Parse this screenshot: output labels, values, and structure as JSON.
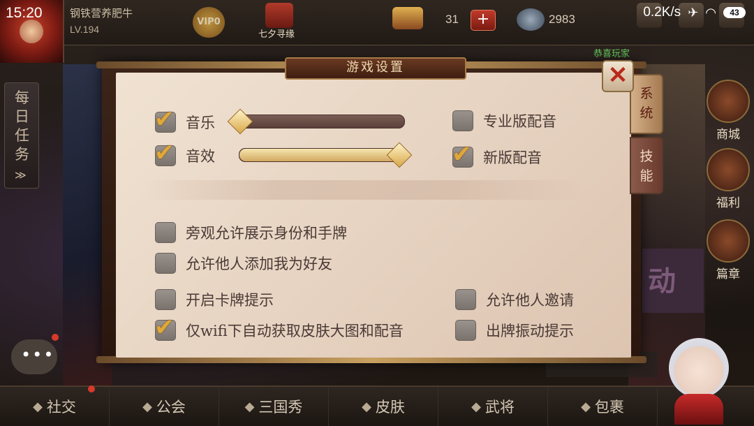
{
  "status_bar": {
    "time": "15:20",
    "network_speed": "0.2K/s",
    "battery": "43"
  },
  "player": {
    "name": "钢铁营养肥牛",
    "level": "LV.194",
    "vip": "VIP0"
  },
  "top_bar": {
    "event_label": "七夕寻缘",
    "gold_count": "31",
    "add_label": "+",
    "coin_count": "2983"
  },
  "daily_tasks": {
    "label": "每日任务",
    "arrow": "≫"
  },
  "side_nav": [
    {
      "label": "商城",
      "icon": "shop-icon"
    },
    {
      "label": "福利",
      "icon": "gift-icon"
    },
    {
      "label": "篇章",
      "icon": "fan-icon"
    }
  ],
  "background": {
    "banner_char": "动"
  },
  "toast": {
    "text": "恭喜玩家"
  },
  "dialog": {
    "title": "游戏设置",
    "close_label": "✕",
    "tabs": [
      {
        "label": "系统",
        "active": true
      },
      {
        "label": "技能",
        "active": false
      }
    ],
    "volume": [
      {
        "label": "音乐",
        "checked": true,
        "level": 0.0
      },
      {
        "label": "音效",
        "checked": true,
        "level": 1.0
      }
    ],
    "voice_options": [
      {
        "label": "专业版配音",
        "checked": false
      },
      {
        "label": "新版配音",
        "checked": true
      }
    ],
    "options_left": [
      {
        "label": "旁观允许展示身份和手牌",
        "checked": false
      },
      {
        "label": "允许他人添加我为好友",
        "checked": false
      },
      {
        "label": "开启卡牌提示",
        "checked": false
      },
      {
        "label": "仅wifi下自动获取皮肤大图和配音",
        "checked": true
      }
    ],
    "options_right": [
      {
        "label": "允许他人邀请",
        "checked": false
      },
      {
        "label": "出牌振动提示",
        "checked": false
      }
    ]
  },
  "bottom_nav": [
    {
      "label": "社交",
      "icon": "chat-icon"
    },
    {
      "label": "公会",
      "icon": "guild-icon"
    },
    {
      "label": "三国秀",
      "icon": "show-icon"
    },
    {
      "label": "皮肤",
      "icon": "skin-icon"
    },
    {
      "label": "武将",
      "icon": "general-icon"
    },
    {
      "label": "包裹",
      "icon": "bag-icon"
    }
  ],
  "colors": {
    "check": "#e0a838",
    "panel": "#e6d2c0",
    "frame": "#3c2418",
    "accent_red": "#b82a1a"
  }
}
